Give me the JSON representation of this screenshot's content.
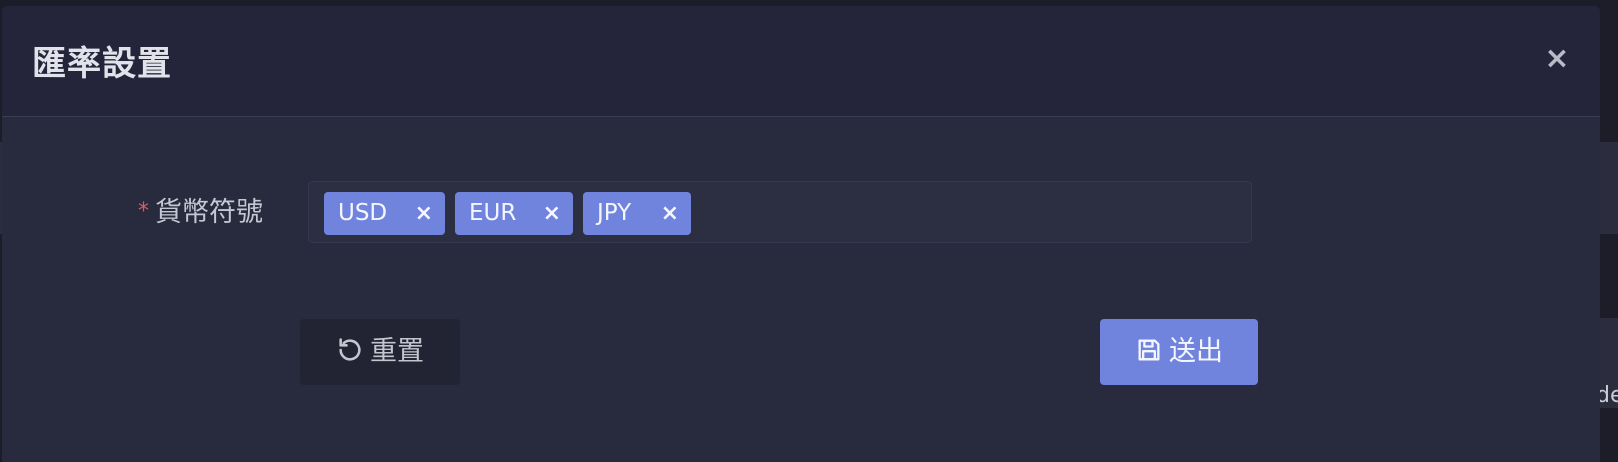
{
  "dialog": {
    "title": "匯率設置",
    "close_label": "×"
  },
  "form": {
    "currency_field": {
      "required_mark": "*",
      "label": "貨幣符號",
      "tags": [
        {
          "label": "USD",
          "remove": "×"
        },
        {
          "label": "EUR",
          "remove": "×"
        },
        {
          "label": "JPY",
          "remove": "×"
        }
      ]
    }
  },
  "actions": {
    "reset_label": "重置",
    "reset_icon": "refresh-icon",
    "submit_label": "送出",
    "submit_icon": "save-icon"
  },
  "background": {
    "edge_text": "de"
  },
  "colors": {
    "accent": "#7184dd",
    "required": "#d95b6a",
    "dialog_bg": "#282a3d",
    "header_bg": "#24253a"
  }
}
